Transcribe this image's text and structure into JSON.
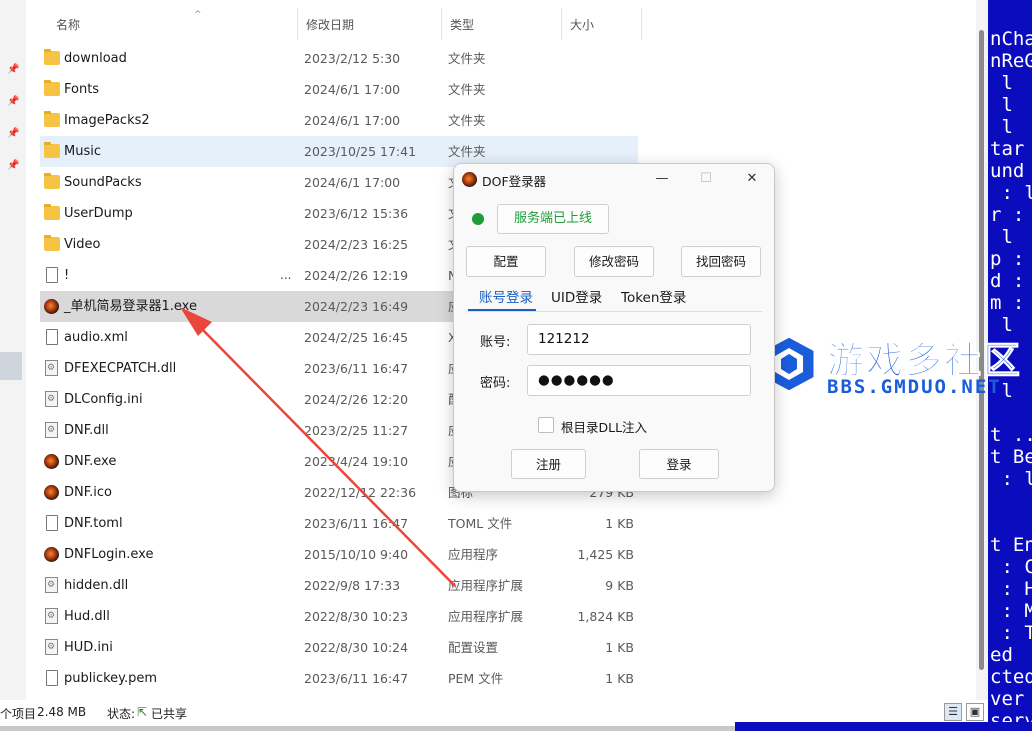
{
  "explorer": {
    "columns": {
      "name": "名称",
      "date": "修改日期",
      "type": "类型",
      "size": "大小"
    },
    "files": [
      {
        "name": "download",
        "date": "2023/2/12 5:30",
        "type": "文件夹",
        "size": "",
        "icon": "folder-icon"
      },
      {
        "name": "Fonts",
        "date": "2024/6/1 17:00",
        "type": "文件夹",
        "size": "",
        "icon": "folder-icon"
      },
      {
        "name": "ImagePacks2",
        "date": "2024/6/1 17:00",
        "type": "文件夹",
        "size": "",
        "icon": "folder-icon"
      },
      {
        "name": "Music",
        "date": "2023/10/25 17:41",
        "type": "文件夹",
        "size": "",
        "icon": "folder-icon"
      },
      {
        "name": "SoundPacks",
        "date": "2024/6/1 17:00",
        "type": "文",
        "size": "",
        "icon": "folder-icon"
      },
      {
        "name": "UserDump",
        "date": "2023/6/12 15:36",
        "type": "文",
        "size": "",
        "icon": "folder-icon"
      },
      {
        "name": "Video",
        "date": "2024/2/23 16:25",
        "type": "文",
        "size": "",
        "icon": "folder-icon"
      },
      {
        "name": "!",
        "date": "2024/2/26 12:19",
        "type": "N",
        "size": "",
        "icon": "document-icon",
        "more": "..."
      },
      {
        "name": "_单机简易登录器1.exe",
        "date": "2024/2/23 16:49",
        "type": "应",
        "size": "",
        "icon": "dnf-app-icon"
      },
      {
        "name": "audio.xml",
        "date": "2024/2/25 16:45",
        "type": "X",
        "size": "",
        "icon": "document-icon"
      },
      {
        "name": "DFEXECPATCH.dll",
        "date": "2023/6/11 16:47",
        "type": "应",
        "size": "",
        "icon": "settings-file-icon"
      },
      {
        "name": "DLConfig.ini",
        "date": "2024/2/26 12:20",
        "type": "配",
        "size": "",
        "icon": "settings-file-icon"
      },
      {
        "name": "DNF.dll",
        "date": "2023/2/25 11:27",
        "type": "应",
        "size": "",
        "icon": "settings-file-icon"
      },
      {
        "name": "DNF.exe",
        "date": "2023/4/24 19:10",
        "type": "应",
        "size": "",
        "icon": "dnf-app-icon"
      },
      {
        "name": "DNF.ico",
        "date": "2022/12/12 22:36",
        "type": "图标",
        "size": "279 KB",
        "icon": "dnf-app-icon"
      },
      {
        "name": "DNF.toml",
        "date": "2023/6/11 16:47",
        "type": "TOML 文件",
        "size": "1 KB",
        "icon": "document-icon"
      },
      {
        "name": "DNFLogin.exe",
        "date": "2015/10/10 9:40",
        "type": "应用程序",
        "size": "1,425 KB",
        "icon": "dnf-app-icon"
      },
      {
        "name": "hidden.dll",
        "date": "2022/9/8 17:33",
        "type": "应用程序扩展",
        "size": "9 KB",
        "icon": "settings-file-icon"
      },
      {
        "name": "Hud.dll",
        "date": "2022/8/30 10:23",
        "type": "应用程序扩展",
        "size": "1,824 KB",
        "icon": "settings-file-icon"
      },
      {
        "name": "HUD.ini",
        "date": "2022/8/30 10:24",
        "type": "配置设置",
        "size": "1 KB",
        "icon": "settings-file-icon"
      },
      {
        "name": "publickey.pem",
        "date": "2023/6/11 16:47",
        "type": "PEM 文件",
        "size": "1 KB",
        "icon": "document-icon"
      }
    ],
    "status": {
      "items": "个项目",
      "selected_size": "2.48 MB",
      "state_label": "状态:",
      "state_value": "已共享"
    }
  },
  "dialog": {
    "title": "DOF登录器",
    "server_status": "服务端已上线",
    "buttons": {
      "config": "配置",
      "change_password": "修改密码",
      "recover_password": "找回密码"
    },
    "tabs": [
      "账号登录",
      "UID登录",
      "Token登录"
    ],
    "account_label": "账号:",
    "account_value": "121212",
    "password_label": "密码:",
    "password_value": "●●●●●●",
    "checkbox_label": "根目录DLL注入",
    "register": "注册",
    "login": "登录",
    "controls": {
      "minimize": "—",
      "maximize": "☐",
      "close": "✕"
    }
  },
  "console": {
    "lines": [
      "nCha",
      "nReG",
      " l",
      " l",
      " l",
      "tar",
      "und",
      " : l",
      "r :",
      " l",
      "p : l",
      "d :",
      "m :",
      " l",
      "",
      "",
      " l",
      "",
      "t ..",
      "t Be",
      " : l",
      "",
      "",
      "t En",
      " : C",
      " : H",
      " : M",
      " : T",
      "ed",
      "cted",
      "ver",
      "serve"
    ]
  },
  "watermark": {
    "title": "游戏多社区",
    "subtitle": "BBS.GMDUO.NET"
  },
  "colors": {
    "accent": "#1a5fc4",
    "online": "#1e9c3a",
    "console_bg": "#0c0cbf",
    "watermark": "#1a5ddb"
  }
}
